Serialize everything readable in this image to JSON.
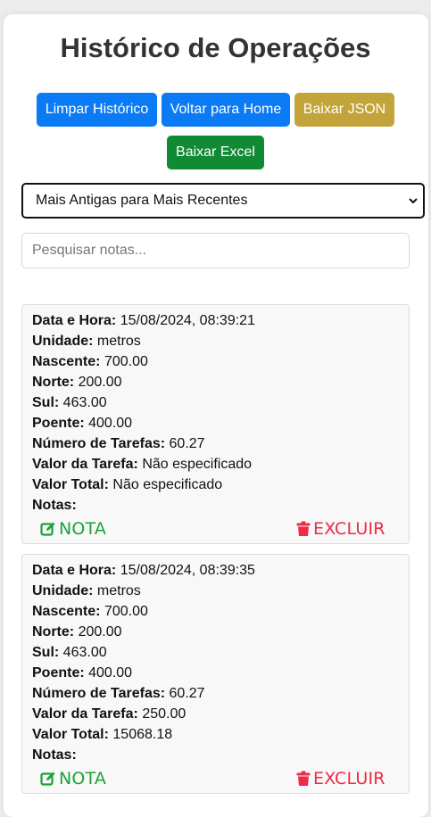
{
  "page": {
    "title": "Histórico de Operações"
  },
  "toolbar": {
    "clear_label": "Limpar Histórico",
    "home_label": "Voltar para Home",
    "json_label": "Baixar JSON",
    "excel_label": "Baixar Excel"
  },
  "sort": {
    "selected": "Mais Antigas para Mais Recentes"
  },
  "search": {
    "placeholder": "Pesquisar notas...",
    "value": ""
  },
  "field_labels": {
    "datetime": "Data e Hora:",
    "unit": "Unidade:",
    "east": "Nascente:",
    "north": "Norte:",
    "south": "Sul:",
    "west": "Poente:",
    "tasks": "Número de Tarefas:",
    "task_value": "Valor da Tarefa:",
    "total": "Valor Total:",
    "notes": "Notas:"
  },
  "actions": {
    "note_label": "NOTA",
    "delete_label": "EXCLUIR"
  },
  "colors": {
    "primary": "#0a7bf5",
    "json_button": "#c2a43a",
    "excel_button": "#108a33",
    "note_action": "#1aa23c",
    "delete_action": "#ee2a44"
  },
  "records": [
    {
      "datetime": "15/08/2024, 08:39:21",
      "unit": "metros",
      "east": "700.00",
      "north": "200.00",
      "south": "463.00",
      "west": "400.00",
      "tasks": "60.27",
      "task_value": "Não especificado",
      "total": "Não especificado",
      "notes": ""
    },
    {
      "datetime": "15/08/2024, 08:39:35",
      "unit": "metros",
      "east": "700.00",
      "north": "200.00",
      "south": "463.00",
      "west": "400.00",
      "tasks": "60.27",
      "task_value": "250.00",
      "total": "15068.18",
      "notes": ""
    }
  ]
}
